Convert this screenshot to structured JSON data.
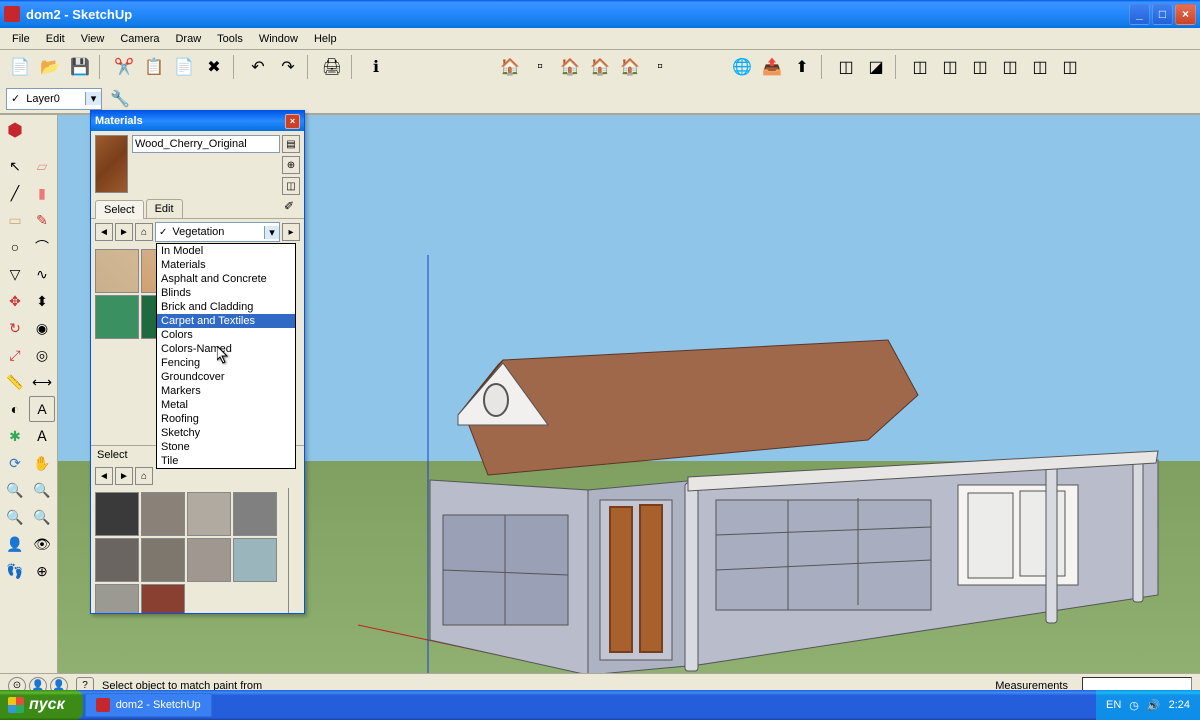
{
  "window": {
    "title": "dom2 - SketchUp"
  },
  "menus": [
    "File",
    "Edit",
    "View",
    "Camera",
    "Draw",
    "Tools",
    "Window",
    "Help"
  ],
  "layer": {
    "current": "Layer0"
  },
  "materials_panel": {
    "title": "Materials",
    "current_material": "Wood_Cherry_Original",
    "tabs": {
      "select": "Select",
      "edit": "Edit"
    },
    "category_selected": "Vegetation",
    "categories": [
      "In Model",
      "Materials",
      "Asphalt and Concrete",
      "Blinds",
      "Brick and Cladding",
      "Carpet and Textiles",
      "Colors",
      "Colors-Named",
      "Fencing",
      "Groundcover",
      "Markers",
      "Metal",
      "Roofing",
      "Sketchy",
      "Stone",
      "Tile"
    ],
    "highlighted_category": "Carpet and Textiles",
    "swatch_colors_top": [
      "#c9b08a",
      "#d0a070",
      "#418a2e",
      "#2a6e48",
      "#3a9060",
      "#1e6a3e"
    ],
    "sub_select_label": "Select",
    "swatch_colors_bottom": [
      "#3a3a3a",
      "#8a8278",
      "#b0aaa0",
      "#808080",
      "#6a6560",
      "#7d776e",
      "#a09890",
      "#9bb5bd",
      "#9a9a92",
      "#8a4030"
    ]
  },
  "statusbar": {
    "message": "Select object to match paint from",
    "measurements_label": "Measurements"
  },
  "taskbar": {
    "start": "пуск",
    "task": "dom2 - SketchUp",
    "lang": "EN",
    "time": "2:24"
  }
}
